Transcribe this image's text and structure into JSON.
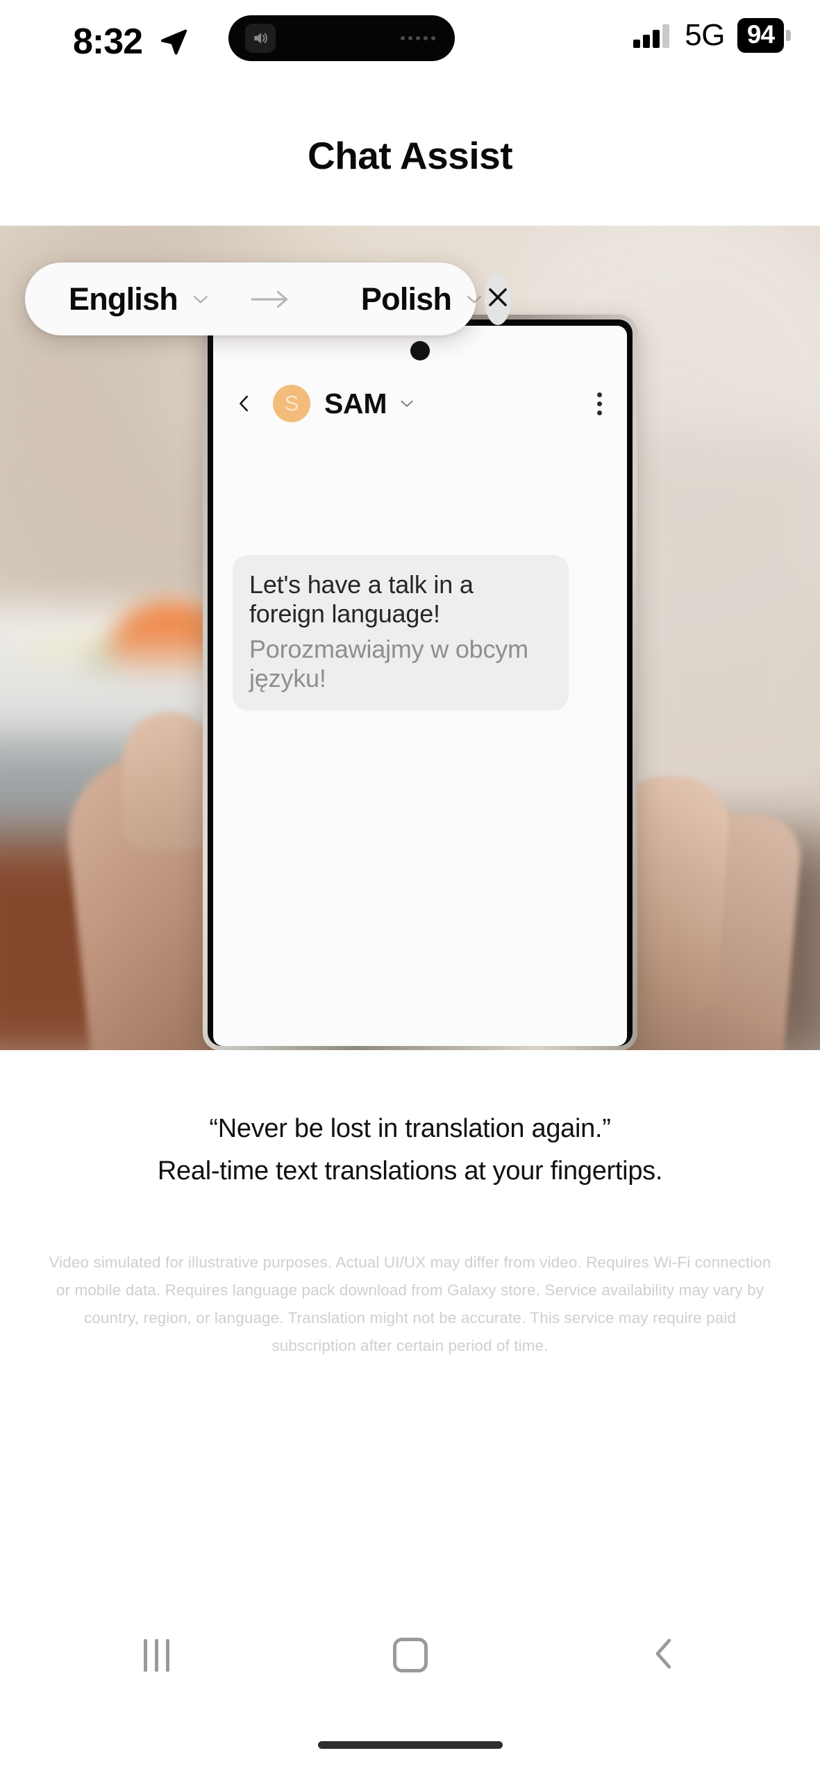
{
  "status_bar": {
    "time": "8:32",
    "location_icon": "location-arrow-icon",
    "island_speaker_icon": "speaker-icon",
    "network_label": "5G",
    "battery_percent": "94",
    "signal_icon": "cellular-signal-icon"
  },
  "header": {
    "title": "Chat Assist"
  },
  "media": {
    "phone_demo": {
      "chat": {
        "back_icon": "chevron-left-icon",
        "avatar_initial": "S",
        "avatar_color": "#f3bc7b",
        "contact_name": "SAM",
        "name_caret_icon": "chevron-down-icon",
        "overflow_icon": "more-vertical-icon"
      },
      "translation_bar": {
        "source_language": "English",
        "source_caret_icon": "chevron-down-icon",
        "direction_icon": "arrow-right-icon",
        "target_language": "Polish",
        "target_caret_icon": "chevron-down-icon",
        "close_icon": "close-x-icon"
      },
      "message": {
        "original_text": "Let's have a talk in a foreign language!",
        "translated_text": "Porozmawiajmy w obcym języku!"
      }
    }
  },
  "captions": {
    "quote": "“Never be lost in translation again.”",
    "subtitle": "Real-time text translations at your fingertips.",
    "disclaimer": "Video simulated for illustrative purposes. Actual UI/UX may differ from video. Requires Wi-Fi connection or mobile data. Requires language pack download from Galaxy store. Service availability may vary by country, region, or language. Translation might not be accurate. This service may require paid subscription after certain period of time."
  },
  "nav_bar": {
    "recents_icon": "recents-icon",
    "home_icon": "home-icon",
    "back_icon": "back-chevron-icon"
  }
}
